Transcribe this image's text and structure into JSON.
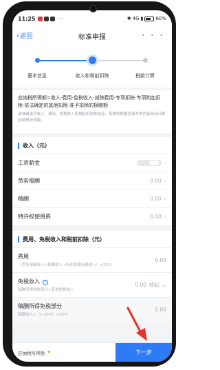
{
  "status_bar": {
    "time": "11:25",
    "network": "4G",
    "battery": "60%"
  },
  "nav": {
    "back_label": "返回",
    "title": "标准申报",
    "more": "• • •"
  },
  "steps": [
    {
      "label": "基本信息",
      "state": "done"
    },
    {
      "label": "收入和税前扣除",
      "state": "current"
    },
    {
      "label": "税款计算",
      "state": "todo"
    }
  ],
  "formula": {
    "main": "应纳税所得额=收入-费用-免税收入-减除费用-专项扣除-专项附加扣除-依法确定的其他扣除-准予扣除的捐赠额",
    "note": "请准确填写收入、费用、免税收入和税前扣除等信息，系统将根据您填写的内容自动计算应纳税所得额。"
  },
  "income_section": {
    "title": "收入（元）",
    "rows": [
      {
        "label": "工资薪金",
        "value": ""
      },
      {
        "label": "劳务报酬",
        "value": "0.00"
      },
      {
        "label": "稿酬",
        "value": "0.00"
      },
      {
        "label": "特许权使用费",
        "value": "0.00"
      }
    ]
  },
  "deduction_section": {
    "title": "费用、免税收入和税前扣除（元）",
    "fee": {
      "label": "费用",
      "sub": "（劳务报酬收入+稿酬收入+特许权使用费收入）×20%",
      "value": "0.00"
    },
    "exempt": {
      "label": "免税收入",
      "sub": "稿酬所得免税部分+其他免税收入",
      "value": "0.00",
      "toggle": "收起"
    },
    "royalty_exempt": {
      "label": "稿酬所得免税部分",
      "sub": "稿酬收入×（1-20%）×30%",
      "value": "0.00"
    }
  },
  "bottom": {
    "tax_due_label": "应纳税所得额",
    "next_label": "下一步"
  },
  "colors": {
    "accent": "#2f7bf5",
    "arrow": "#e8302c"
  }
}
